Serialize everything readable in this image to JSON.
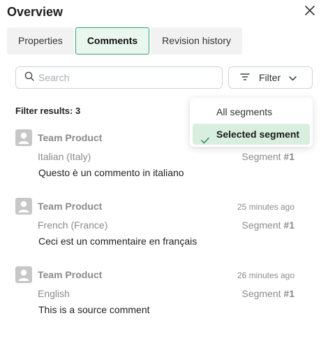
{
  "header": {
    "title": "Overview"
  },
  "tabs": [
    {
      "label": "Properties"
    },
    {
      "label": "Comments"
    },
    {
      "label": "Revision history"
    }
  ],
  "search": {
    "placeholder": "Search",
    "value": ""
  },
  "filter": {
    "label": "Filter"
  },
  "results": {
    "label": "Filter results: 3"
  },
  "dropdown": {
    "options": [
      {
        "label": "All segments",
        "selected": false
      },
      {
        "label": "Selected segment",
        "selected": true
      }
    ]
  },
  "comments": [
    {
      "author": "Team Product",
      "time": "",
      "language": "Italian (Italy)",
      "segment_prefix": "Segment ",
      "segment_num": "#1",
      "text": "Questo è un commento in italiano"
    },
    {
      "author": "Team Product",
      "time": "25 minutes ago",
      "language": "French (France)",
      "segment_prefix": "Segment ",
      "segment_num": "#1",
      "text": "Ceci est un commentaire en français"
    },
    {
      "author": "Team Product",
      "time": "26 minutes ago",
      "language": "English",
      "segment_prefix": "Segment ",
      "segment_num": "#1",
      "text": "This is a source comment"
    }
  ],
  "colors": {
    "accent": "#30a86a",
    "selected_bg": "#d8eedf",
    "muted": "#8a8a8a"
  },
  "icons": {
    "close": "close-icon",
    "search": "search-icon",
    "filter": "filter-icon",
    "chevron": "chevron-down-icon",
    "check": "check-icon",
    "avatar": "user-avatar-icon"
  }
}
